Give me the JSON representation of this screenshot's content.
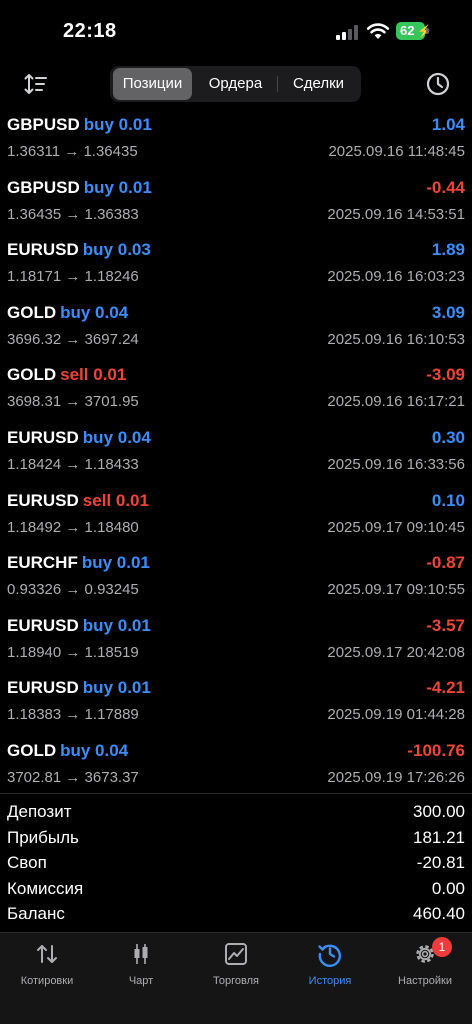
{
  "status": {
    "time": "22:18",
    "battery": "62"
  },
  "tabs_top": {
    "positions": "Позиции",
    "orders": "Ордера",
    "deals": "Сделки"
  },
  "trades": [
    {
      "symbol": "GBPUSD",
      "dir_vol": "buy 0.01",
      "side": "buy",
      "profit": "1.04",
      "profit_sign": "pos",
      "prices": "1.36311 → 1.36435",
      "time": "2025.09.16 11:48:45"
    },
    {
      "symbol": "GBPUSD",
      "dir_vol": "buy 0.01",
      "side": "buy",
      "profit": "-0.44",
      "profit_sign": "neg",
      "prices": "1.36435 → 1.36383",
      "time": "2025.09.16 14:53:51"
    },
    {
      "symbol": "EURUSD",
      "dir_vol": "buy 0.03",
      "side": "buy",
      "profit": "1.89",
      "profit_sign": "pos",
      "prices": "1.18171 → 1.18246",
      "time": "2025.09.16 16:03:23"
    },
    {
      "symbol": "GOLD",
      "dir_vol": "buy 0.04",
      "side": "buy",
      "profit": "3.09",
      "profit_sign": "pos",
      "prices": "3696.32 → 3697.24",
      "time": "2025.09.16 16:10:53"
    },
    {
      "symbol": "GOLD",
      "dir_vol": "sell 0.01",
      "side": "sell",
      "profit": "-3.09",
      "profit_sign": "neg",
      "prices": "3698.31 → 3701.95",
      "time": "2025.09.16 16:17:21"
    },
    {
      "symbol": "EURUSD",
      "dir_vol": "buy 0.04",
      "side": "buy",
      "profit": "0.30",
      "profit_sign": "pos",
      "prices": "1.18424 → 1.18433",
      "time": "2025.09.16 16:33:56"
    },
    {
      "symbol": "EURUSD",
      "dir_vol": "sell 0.01",
      "side": "sell",
      "profit": "0.10",
      "profit_sign": "pos",
      "prices": "1.18492 → 1.18480",
      "time": "2025.09.17 09:10:45"
    },
    {
      "symbol": "EURCHF",
      "dir_vol": "buy 0.01",
      "side": "buy",
      "profit": "-0.87",
      "profit_sign": "neg",
      "prices": "0.93326 → 0.93245",
      "time": "2025.09.17 09:10:55"
    },
    {
      "symbol": "EURUSD",
      "dir_vol": "buy 0.01",
      "side": "buy",
      "profit": "-3.57",
      "profit_sign": "neg",
      "prices": "1.18940 → 1.18519",
      "time": "2025.09.17 20:42:08"
    },
    {
      "symbol": "EURUSD",
      "dir_vol": "buy 0.01",
      "side": "buy",
      "profit": "-4.21",
      "profit_sign": "neg",
      "prices": "1.18383 → 1.17889",
      "time": "2025.09.19 01:44:28"
    },
    {
      "symbol": "GOLD",
      "dir_vol": "buy 0.04",
      "side": "buy",
      "profit": "-100.76",
      "profit_sign": "neg",
      "prices": "3702.81 → 3673.37",
      "time": "2025.09.19 17:26:26"
    }
  ],
  "summary": [
    {
      "label": "Депозит",
      "value": "300.00"
    },
    {
      "label": "Прибыль",
      "value": "181.21"
    },
    {
      "label": "Своп",
      "value": "-20.81"
    },
    {
      "label": "Комиссия",
      "value": "0.00"
    },
    {
      "label": "Баланс",
      "value": "460.40"
    }
  ],
  "tab_bar": {
    "quotes": "Котировки",
    "chart": "Чарт",
    "trade": "Торговля",
    "history": "История",
    "settings": "Настройки",
    "settings_badge": "1"
  },
  "colors": {
    "buy": "#3b8efa",
    "sell": "#f04438",
    "positive": "#3b8efa",
    "negative": "#f04438",
    "battery": "#35c759"
  },
  "icons": [
    "sort-icon",
    "clock-icon",
    "arrows-updown-icon",
    "candlestick-icon",
    "line-chart-icon",
    "history-icon",
    "gear-icon"
  ]
}
